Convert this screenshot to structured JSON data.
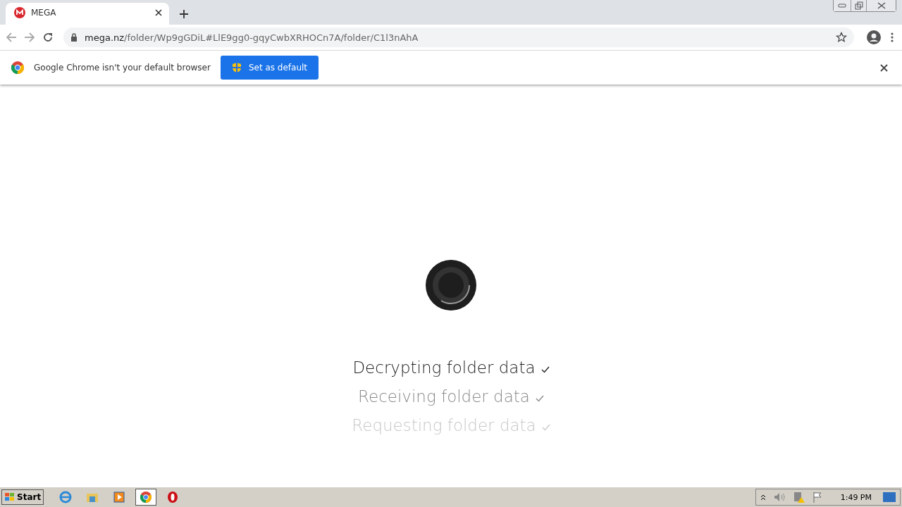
{
  "tab": {
    "title": "MEGA",
    "selected": true
  },
  "address": {
    "host": "mega.nz",
    "path": "/folder/Wp9gGDiL#LlE9gg0-gqyCwbXRHOCn7A/folder/C1l3nAhA"
  },
  "infobar": {
    "message": "Google Chrome isn't your default browser",
    "button": "Set as default"
  },
  "steps": [
    {
      "label": "Decrypting folder data",
      "done": true,
      "color": "#222222"
    },
    {
      "label": "Receiving folder data",
      "done": true,
      "color": "#8a8a8a"
    },
    {
      "label": "Requesting folder data",
      "done": true,
      "color": "#c8c8c8"
    }
  ],
  "taskbar": {
    "start": "Start",
    "clock": "1:49 PM"
  }
}
